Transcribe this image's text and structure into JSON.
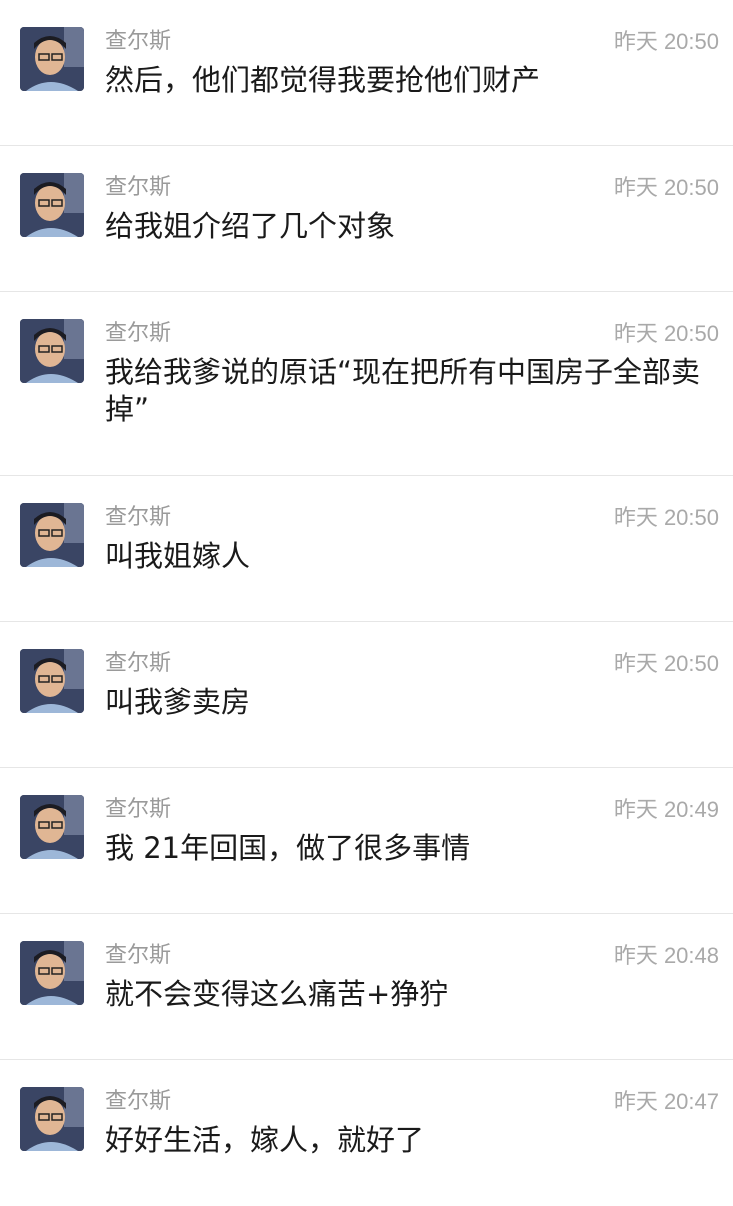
{
  "messages": [
    {
      "sender": "查尔斯",
      "time": "昨天 20:50",
      "text": "然后，他们都觉得我要抢他们财产"
    },
    {
      "sender": "查尔斯",
      "time": "昨天 20:50",
      "text": "给我姐介绍了几个对象"
    },
    {
      "sender": "查尔斯",
      "time": "昨天 20:50",
      "text": "我给我爹说的原话“现在把所有中国房子全部卖掉”"
    },
    {
      "sender": "查尔斯",
      "time": "昨天 20:50",
      "text": "叫我姐嫁人"
    },
    {
      "sender": "查尔斯",
      "time": "昨天 20:50",
      "text": "叫我爹卖房"
    },
    {
      "sender": "查尔斯",
      "time": "昨天 20:49",
      "text": "我 21年回国，做了很多事情"
    },
    {
      "sender": "查尔斯",
      "time": "昨天 20:48",
      "text": "就不会变得这么痛苦+狰狞"
    },
    {
      "sender": "查尔斯",
      "time": "昨天 20:47",
      "text": "好好生活，嫁人，就好了"
    }
  ]
}
